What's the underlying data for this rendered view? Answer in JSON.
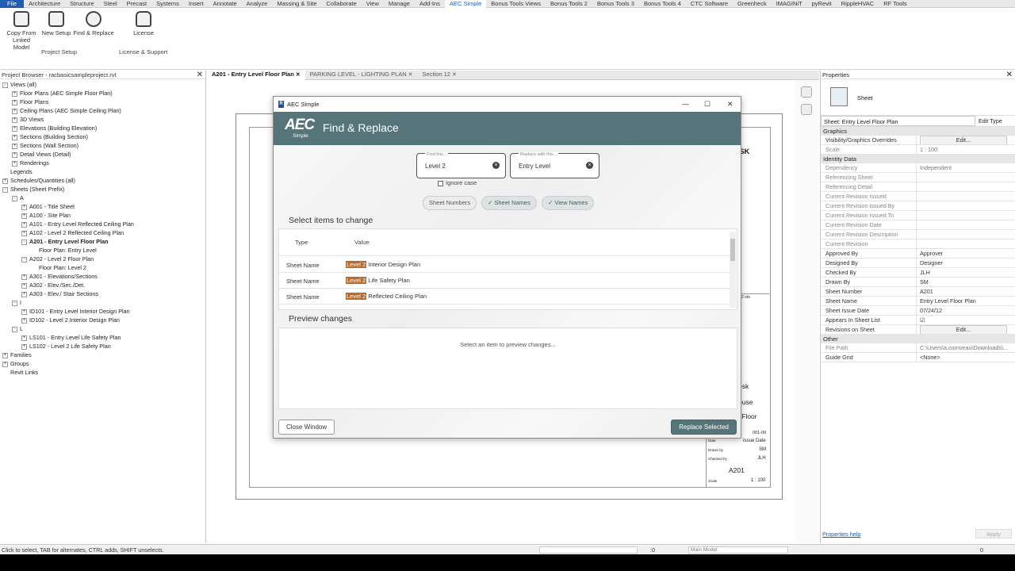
{
  "menubar": [
    "File",
    "Architecture",
    "Structure",
    "Steel",
    "Precast",
    "Systems",
    "Insert",
    "Annotate",
    "Analyze",
    "Massing & Site",
    "Collaborate",
    "View",
    "Manage",
    "Add-Ins",
    "AEC Simple",
    "Bonus Tools Views",
    "Bonus Tools 2",
    "Bonus Tools 3",
    "Bonus Tools 4",
    "CTC Software",
    "Greenheck",
    "IMAGINiT",
    "pyRevit",
    "RippleHVAC",
    "RF Tools"
  ],
  "ribbon": {
    "buttons": [
      {
        "label1": "Copy From",
        "label2": "Linked Model"
      },
      {
        "label1": "New Setup",
        "label2": ""
      },
      {
        "label1": "Find & Replace",
        "label2": ""
      },
      {
        "label1": "License",
        "label2": ""
      }
    ],
    "groups": [
      "Project Setup",
      "License & Support"
    ]
  },
  "project_browser": {
    "title": "Project Browser - racbasicsampleproject.rvt",
    "items": [
      {
        "t": "Views (all)",
        "lvl": 0,
        "box": "-"
      },
      {
        "t": "Floor Plans (AEC Simple Floor Plan)",
        "lvl": 1,
        "box": "+"
      },
      {
        "t": "Floor Plans",
        "lvl": 1,
        "box": "+"
      },
      {
        "t": "Ceiling Plans (AEC Simple Ceiling Plan)",
        "lvl": 1,
        "box": "+"
      },
      {
        "t": "3D Views",
        "lvl": 1,
        "box": "+"
      },
      {
        "t": "Elevations (Building Elevation)",
        "lvl": 1,
        "box": "+"
      },
      {
        "t": "Sections (Building Section)",
        "lvl": 1,
        "box": "+"
      },
      {
        "t": "Sections (Wall Section)",
        "lvl": 1,
        "box": "+"
      },
      {
        "t": "Detail Views (Detail)",
        "lvl": 1,
        "box": "+"
      },
      {
        "t": "Renderings",
        "lvl": 1,
        "box": "+"
      },
      {
        "t": "Legends",
        "lvl": 0,
        "box": ""
      },
      {
        "t": "Schedules/Quantities (all)",
        "lvl": 0,
        "box": "+"
      },
      {
        "t": "Sheets (Sheet Prefix)",
        "lvl": 0,
        "box": "-"
      },
      {
        "t": "A",
        "lvl": 1,
        "box": "-"
      },
      {
        "t": "A001 - Title Sheet",
        "lvl": 2,
        "box": "+"
      },
      {
        "t": "A100 - Site Plan",
        "lvl": 2,
        "box": "+"
      },
      {
        "t": "A101 - Entry Level  Reflected Ceiling Plan",
        "lvl": 2,
        "box": "+"
      },
      {
        "t": "A102 - Level 2  Reflected Ceiling Plan",
        "lvl": 2,
        "box": "+"
      },
      {
        "t": "A201 - Entry Level Floor Plan",
        "lvl": 2,
        "box": "-",
        "sel": true
      },
      {
        "t": "Floor Plan: Entry Level",
        "lvl": 3,
        "box": ""
      },
      {
        "t": "A202 - Level 2 Floor Plan",
        "lvl": 2,
        "box": "-"
      },
      {
        "t": "Floor Plan: Level 2",
        "lvl": 3,
        "box": ""
      },
      {
        "t": "A301 - Elevations/Sections",
        "lvl": 2,
        "box": "+"
      },
      {
        "t": "A302 - Elev./Sec./Det.",
        "lvl": 2,
        "box": "+"
      },
      {
        "t": "A303 - Elev./ Stair Sections",
        "lvl": 2,
        "box": "+"
      },
      {
        "t": "I",
        "lvl": 1,
        "box": "-"
      },
      {
        "t": "ID101 - Entry Level  Interior Design Plan",
        "lvl": 2,
        "box": "+"
      },
      {
        "t": "ID102 - Level 2  Interior Design Plan",
        "lvl": 2,
        "box": "+"
      },
      {
        "t": "L",
        "lvl": 1,
        "box": "-"
      },
      {
        "t": "LS101 - Entry Level  Life Safety Plan",
        "lvl": 2,
        "box": "+"
      },
      {
        "t": "LS102 - Level 2  Life Safety Plan",
        "lvl": 2,
        "box": "+"
      },
      {
        "t": "Families",
        "lvl": 0,
        "box": "+"
      },
      {
        "t": "Groups",
        "lvl": 0,
        "box": "+"
      },
      {
        "t": "Revit Links",
        "lvl": 0,
        "box": ""
      }
    ]
  },
  "tabs": [
    {
      "label": "A201 - Entry Level Floor Plan",
      "active": true
    },
    {
      "label": "PARKING LEVEL - LIGHTING PLAN",
      "active": false
    },
    {
      "label": "Section 12",
      "active": false
    }
  ],
  "titleblock": {
    "desk1": "DESK",
    "desk2": "esk",
    "house": "ouse",
    "floor": "l Floor",
    "num": "001-00",
    "issue": "Issue Date",
    "sm": "SM",
    "jlh": "JLH",
    "sheet": "A201",
    "scale": "1 : 100",
    "drawn_by": "Drawn by",
    "checked_by": "Checked by",
    "scale_label": "Scale",
    "date_label": "Date",
    "bar": "2 ots"
  },
  "properties": {
    "title": "Properties",
    "family": "Sheet",
    "selector": "Sheet: Entry Level Floor Plan",
    "edit_type": "Edit Type",
    "sections": [
      {
        "name": "Graphics",
        "rows": [
          {
            "k": "Visibility/Graphics Overrides",
            "v": "Edit...",
            "btn": true
          },
          {
            "k": "Scale",
            "v": "1 : 100",
            "grey": true
          }
        ]
      },
      {
        "name": "Identity Data",
        "rows": [
          {
            "k": "Dependency",
            "v": "Independent",
            "grey": true
          },
          {
            "k": "Referencing Sheet",
            "v": "",
            "grey": true
          },
          {
            "k": "Referencing Detail",
            "v": "",
            "grey": true
          },
          {
            "k": "Current Revision Issued",
            "v": "",
            "grey": true
          },
          {
            "k": "Current Revision Issued By",
            "v": "",
            "grey": true
          },
          {
            "k": "Current Revision Issued To",
            "v": "",
            "grey": true
          },
          {
            "k": "Current Revision Date",
            "v": "",
            "grey": true
          },
          {
            "k": "Current Revision Description",
            "v": "",
            "grey": true
          },
          {
            "k": "Current Revision",
            "v": "",
            "grey": true
          },
          {
            "k": "Approved By",
            "v": "Approver"
          },
          {
            "k": "Designed By",
            "v": "Designer"
          },
          {
            "k": "Checked By",
            "v": "JLH"
          },
          {
            "k": "Drawn By",
            "v": "SM"
          },
          {
            "k": "Sheet Number",
            "v": "A201"
          },
          {
            "k": "Sheet Name",
            "v": "Entry Level Floor Plan"
          },
          {
            "k": "Sheet Issue Date",
            "v": "07/24/12"
          },
          {
            "k": "Appears In Sheet List",
            "v": "☑"
          },
          {
            "k": "Revisions on Sheet",
            "v": "Edit...",
            "btn": true
          }
        ]
      },
      {
        "name": "Other",
        "rows": [
          {
            "k": "File Path",
            "v": "C:\\Users\\a.cornveau\\Downloads\\...",
            "grey": true
          },
          {
            "k": "Guide Grid",
            "v": "<None>"
          }
        ]
      }
    ],
    "help": "Properties help",
    "apply": "Apply"
  },
  "status": {
    "text": "Click to select, TAB for alternates, CTRL adds, SHIFT unselects.",
    "zero1": ":0",
    "model": "Main Model",
    "zero2": "0"
  },
  "dialog": {
    "window_title": "AEC Simple",
    "logo": "AEC",
    "logo_sub": "Simple",
    "title": "Find & Replace",
    "find": {
      "label": "Find this...",
      "value": "Level 2"
    },
    "replace": {
      "label": "Replace with this...",
      "value": "Entry Level"
    },
    "ignore_case": "Ignore case",
    "chips": [
      {
        "label": "Sheet Numbers",
        "on": false
      },
      {
        "label": "Sheet Names",
        "on": true
      },
      {
        "label": "View Names",
        "on": true
      }
    ],
    "select_heading": "Select items to change",
    "columns": [
      "Type",
      "Value"
    ],
    "rows": [
      {
        "type": "Sheet Name",
        "match": "Level 2",
        "rest": " Interior Design Plan"
      },
      {
        "type": "Sheet Name",
        "match": "Level 2",
        "rest": " Life Safety Plan"
      },
      {
        "type": "Sheet Name",
        "match": "Level 2",
        "rest": " Reflected Ceiling Plan"
      }
    ],
    "preview_heading": "Preview changes",
    "preview_msg": "Select an item to preview changes...",
    "close_btn": "Close Window",
    "replace_btn": "Replace Selected"
  }
}
